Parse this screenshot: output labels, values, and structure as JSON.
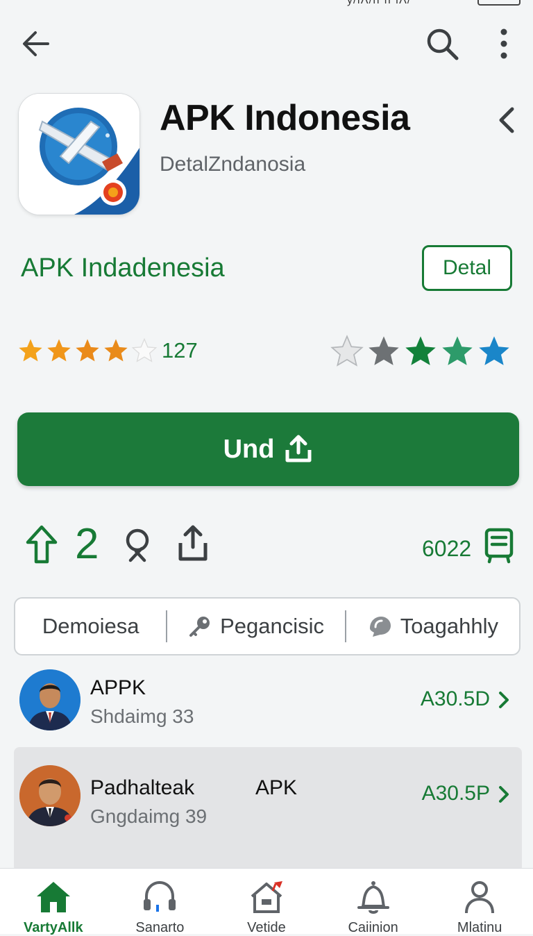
{
  "status_bar": {
    "fragment": "ÿ/ıΛ/ıı ıı ıΛ/"
  },
  "app": {
    "title": "APK Indonesia",
    "subtitle": "DetalZndanosia",
    "developer": "APK Indadenesia",
    "detail_button": "Detal",
    "rating_count": "127",
    "rating_value": 4,
    "install_label": "Und"
  },
  "actions": {
    "count": "2",
    "downloads": "6022"
  },
  "tabs": [
    {
      "label": "Demoiesa"
    },
    {
      "label": "Pegancisic"
    },
    {
      "label": "Toagahhly"
    }
  ],
  "list": [
    {
      "name": "APPK",
      "subtitle": "Shdaimg 33",
      "price": "A30.5D",
      "tag": ""
    },
    {
      "name": "Padhalteak",
      "subtitle": "Gngdaimg 39",
      "price": "A30.5P",
      "tag": "APK"
    }
  ],
  "bottom_nav": [
    {
      "label": "VartyAllk",
      "icon": "home-icon"
    },
    {
      "label": "Sanarto",
      "icon": "headset-icon"
    },
    {
      "label": "Vetide",
      "icon": "house-flag-icon"
    },
    {
      "label": "Caiinion",
      "icon": "bell-icon"
    },
    {
      "label": "Mlatinu",
      "icon": "person-icon"
    }
  ],
  "colors": {
    "accent": "#1c7a3a",
    "text_green": "#177a35",
    "background": "#f3f5f6"
  }
}
